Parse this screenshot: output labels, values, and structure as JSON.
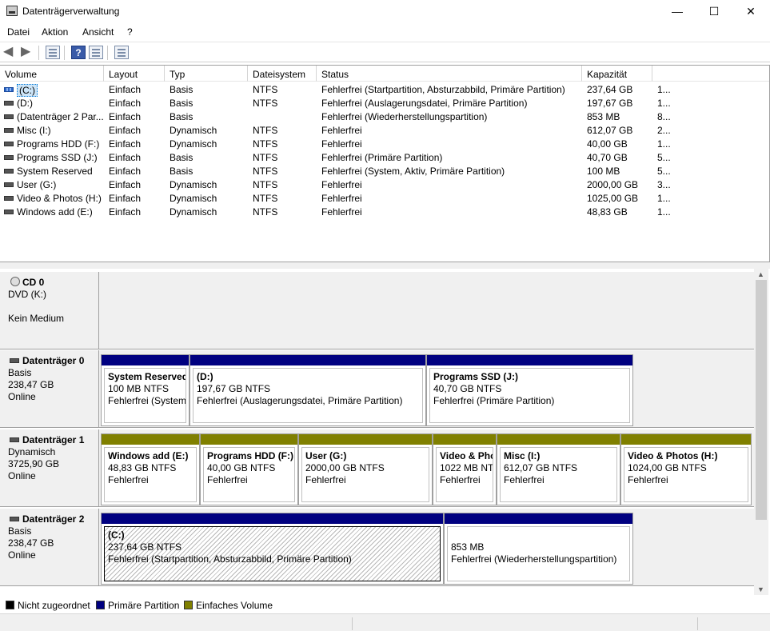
{
  "window": {
    "title": "Datenträgerverwaltung",
    "minimize": "—",
    "maximize": "☐",
    "close": "✕"
  },
  "menu": [
    "Datei",
    "Aktion",
    "Ansicht",
    "?"
  ],
  "toolbar": {
    "icons": [
      "back-arrow-icon",
      "forward-arrow-icon",
      "properties-icon",
      "help-icon",
      "view-icon",
      "list-icon"
    ],
    "help_label": "?"
  },
  "list": {
    "columns": [
      "Volume",
      "Layout",
      "Typ",
      "Dateisystem",
      "Status",
      "Kapazität",
      ""
    ],
    "rows": [
      {
        "volume": "(C:)",
        "layout": "Einfach",
        "typ": "Basis",
        "fs": "NTFS",
        "status": "Fehlerfrei (Startpartition, Absturzabbild, Primäre Partition)",
        "kap": "237,64 GB",
        "extra": "1..."
      },
      {
        "volume": "(D:)",
        "layout": "Einfach",
        "typ": "Basis",
        "fs": "NTFS",
        "status": "Fehlerfrei (Auslagerungsdatei, Primäre Partition)",
        "kap": "197,67 GB",
        "extra": "1..."
      },
      {
        "volume": "(Datenträger 2 Par...",
        "layout": "Einfach",
        "typ": "Basis",
        "fs": "",
        "status": "Fehlerfrei (Wiederherstellungspartition)",
        "kap": "853 MB",
        "extra": "8..."
      },
      {
        "volume": "Misc (I:)",
        "layout": "Einfach",
        "typ": "Dynamisch",
        "fs": "NTFS",
        "status": "Fehlerfrei",
        "kap": "612,07 GB",
        "extra": "2..."
      },
      {
        "volume": "Programs HDD (F:)",
        "layout": "Einfach",
        "typ": "Dynamisch",
        "fs": "NTFS",
        "status": "Fehlerfrei",
        "kap": "40,00 GB",
        "extra": "1..."
      },
      {
        "volume": "Programs SSD (J:)",
        "layout": "Einfach",
        "typ": "Basis",
        "fs": "NTFS",
        "status": "Fehlerfrei (Primäre Partition)",
        "kap": "40,70 GB",
        "extra": "5..."
      },
      {
        "volume": "System Reserved",
        "layout": "Einfach",
        "typ": "Basis",
        "fs": "NTFS",
        "status": "Fehlerfrei (System, Aktiv, Primäre Partition)",
        "kap": "100 MB",
        "extra": "5..."
      },
      {
        "volume": "User (G:)",
        "layout": "Einfach",
        "typ": "Dynamisch",
        "fs": "NTFS",
        "status": "Fehlerfrei",
        "kap": "2000,00 GB",
        "extra": "3..."
      },
      {
        "volume": "Video & Photos (H:)",
        "layout": "Einfach",
        "typ": "Dynamisch",
        "fs": "NTFS",
        "status": "Fehlerfrei",
        "kap": "1025,00 GB",
        "extra": "1..."
      },
      {
        "volume": "Windows add (E:)",
        "layout": "Einfach",
        "typ": "Dynamisch",
        "fs": "NTFS",
        "status": "Fehlerfrei",
        "kap": "48,83 GB",
        "extra": "1..."
      }
    ]
  },
  "disks": {
    "cd0": {
      "name": "CD 0",
      "line1": "DVD (K:)",
      "line2": "",
      "line3": "Kein Medium"
    },
    "d0": {
      "name": "Datenträger 0",
      "line1": "Basis",
      "line2": "238,47 GB",
      "line3": "Online",
      "parts": [
        {
          "name": "System Reserved",
          "size": "100 MB NTFS",
          "status": "Fehlerfrei (System,"
        },
        {
          "name": "(D:)",
          "size": "197,67 GB NTFS",
          "status": "Fehlerfrei (Auslagerungsdatei, Primäre Partition)"
        },
        {
          "name": "Programs SSD  (J:)",
          "size": "40,70 GB NTFS",
          "status": "Fehlerfrei (Primäre Partition)"
        }
      ]
    },
    "d1": {
      "name": "Datenträger 1",
      "line1": "Dynamisch",
      "line2": "3725,90 GB",
      "line3": "Online",
      "parts": [
        {
          "name": "Windows add  (E:)",
          "size": "48,83 GB NTFS",
          "status": "Fehlerfrei"
        },
        {
          "name": "Programs HDD  (F:)",
          "size": "40,00 GB NTFS",
          "status": "Fehlerfrei"
        },
        {
          "name": "User  (G:)",
          "size": "2000,00 GB NTFS",
          "status": "Fehlerfrei"
        },
        {
          "name": "Video & Pho",
          "size": "1022 MB NT",
          "status": "Fehlerfrei"
        },
        {
          "name": "Misc  (I:)",
          "size": "612,07 GB NTFS",
          "status": "Fehlerfrei"
        },
        {
          "name": "Video & Photos  (H:)",
          "size": "1024,00 GB NTFS",
          "status": "Fehlerfrei"
        }
      ]
    },
    "d2": {
      "name": "Datenträger 2",
      "line1": "Basis",
      "line2": "238,47 GB",
      "line3": "Online",
      "parts": [
        {
          "name": "(C:)",
          "size": "237,64 GB NTFS",
          "status": "Fehlerfrei (Startpartition, Absturzabbild, Primäre Partition)"
        },
        {
          "name": "",
          "size": "853 MB",
          "status": "Fehlerfrei (Wiederherstellungspartition)"
        }
      ]
    }
  },
  "legend": [
    {
      "label": "Nicht zugeordnet",
      "color": "#000000"
    },
    {
      "label": "Primäre Partition",
      "color": "#000080"
    },
    {
      "label": "Einfaches Volume",
      "color": "#808000"
    }
  ],
  "colors": {
    "primary": "#000080",
    "simple": "#808000",
    "selection": "#cce4f7"
  }
}
